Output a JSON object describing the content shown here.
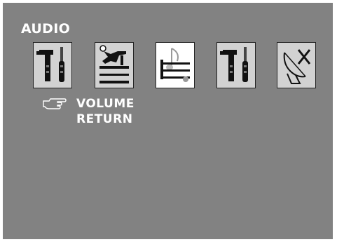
{
  "menu_title": "AUDIO",
  "icons": [
    {
      "name": "tools-icon"
    },
    {
      "name": "person-setup-icon"
    },
    {
      "name": "audio-note-icon"
    },
    {
      "name": "tools-icon-2"
    },
    {
      "name": "satellite-dish-off-icon"
    }
  ],
  "menu_items": [
    {
      "label": "VOLUME",
      "selected": true
    },
    {
      "label": "RETURN",
      "selected": false
    }
  ],
  "colors": {
    "screen_background": "#828282",
    "text": "#ffffff",
    "tile_highlight": "#ffffff",
    "tile_default": "#d2d2d2"
  }
}
